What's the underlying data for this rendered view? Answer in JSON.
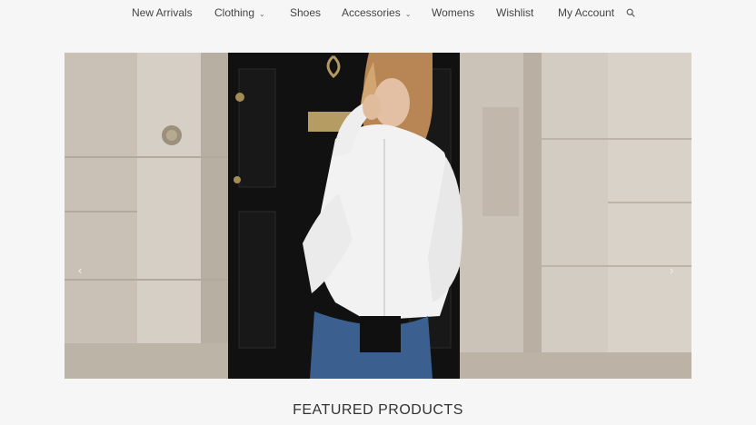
{
  "nav": {
    "items": [
      {
        "label": "New Arrivals",
        "has_dropdown": false
      },
      {
        "label": "Clothing",
        "has_dropdown": true
      },
      {
        "label": "Shoes",
        "has_dropdown": false
      },
      {
        "label": "Accessories",
        "has_dropdown": true
      },
      {
        "label": "Womens",
        "has_dropdown": false
      },
      {
        "label": "Wishlist",
        "has_dropdown": false
      },
      {
        "label": "My Account",
        "has_dropdown": false
      }
    ],
    "chevron_glyph": "⌄",
    "search_icon": "search-icon"
  },
  "hero": {
    "prev_glyph": "‹",
    "next_glyph": "›",
    "slide_count": 2,
    "active_slide": 1
  },
  "featured": {
    "heading": "FEATURED PRODUCTS"
  },
  "colors": {
    "background": "#f6f6f6",
    "text": "#333333",
    "stone": "#cfc8bf",
    "door": "#111111",
    "shirt": "#f2f2f2",
    "jeans": "#3b5f8f",
    "hair": "#b88655"
  }
}
